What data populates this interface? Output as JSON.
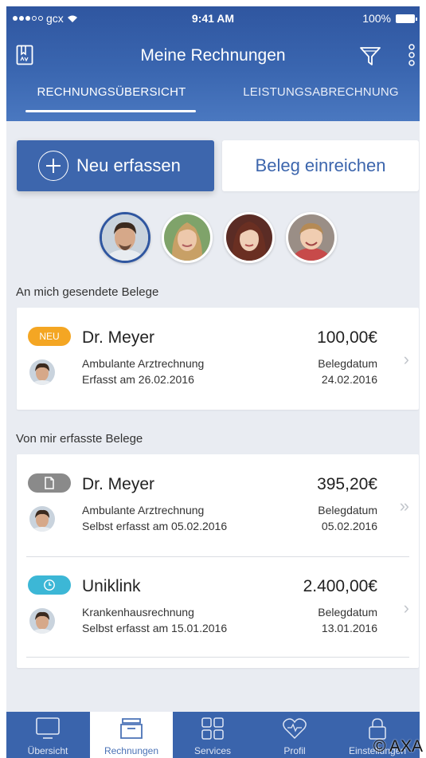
{
  "status_bar": {
    "carrier": "gcx",
    "time": "9:41 AM",
    "battery": "100%"
  },
  "header": {
    "title": "Meine Rechnungen",
    "icons": [
      "book-icon",
      "filter-icon",
      "more-icon"
    ],
    "tabs": [
      {
        "label": "RECHNUNGSÜBERSICHT",
        "active": true
      },
      {
        "label": "LEISTUNGSABRECHNUNG",
        "active": false
      }
    ]
  },
  "actions": {
    "new_label": "Neu erfassen",
    "submit_label": "Beleg einreichen"
  },
  "sections": {
    "received_label": "An mich gesendete Belege",
    "own_label": "Von mir erfasste Belege"
  },
  "received": [
    {
      "badge": "NEU",
      "name": "Dr. Meyer",
      "amount": "100,00€",
      "type": "Ambulante Arztrechnung",
      "date": "Erfasst am 26.02.2016",
      "date_label": "Belegdatum",
      "date_value": "24.02.2016"
    }
  ],
  "own": [
    {
      "badge_icon": "document-icon",
      "name": "Dr. Meyer",
      "amount": "395,20€",
      "type": "Ambulante Arztrechnung",
      "date": "Selbst erfasst am 05.02.2016",
      "date_label": "Belegdatum",
      "date_value": "05.02.2016"
    },
    {
      "badge_icon": "clock-icon",
      "name": "Uniklink",
      "amount": "2.400,00€",
      "type": "Krankenhausrechnung",
      "date": "Selbst erfasst am 15.01.2016",
      "date_label": "Belegdatum",
      "date_value": "13.01.2016"
    }
  ],
  "tabbar": [
    {
      "label": "Übersicht",
      "icon": "monitor-icon",
      "active": false
    },
    {
      "label": "Rechnungen",
      "icon": "inbox-icon",
      "active": true
    },
    {
      "label": "Services",
      "icon": "grid-icon",
      "active": false
    },
    {
      "label": "Profil",
      "icon": "heart-pulse-icon",
      "active": false
    },
    {
      "label": "Einstellungen",
      "icon": "lock-icon",
      "active": false
    }
  ],
  "copyright": "© AXA",
  "colors": {
    "brand_blue": "#3d66ad",
    "new_badge": "#f4a623",
    "clock_badge": "#3cb7d6",
    "doc_badge": "#8a8a8a"
  }
}
